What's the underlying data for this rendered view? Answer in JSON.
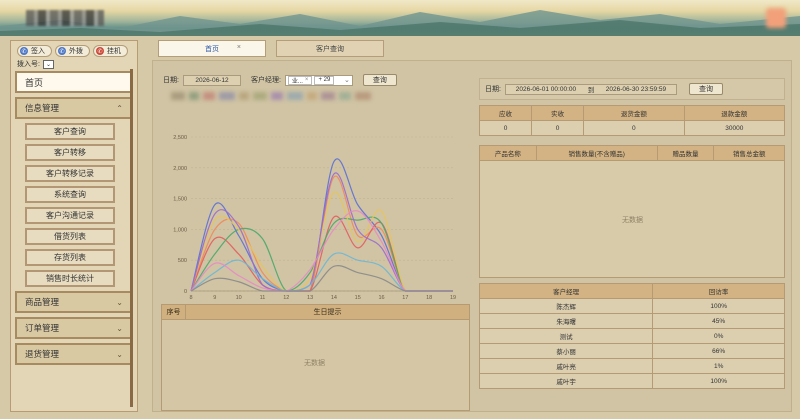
{
  "sidebar": {
    "buttons": [
      {
        "label": "签入",
        "color": "#4d77c6"
      },
      {
        "label": "外拨",
        "color": "#4d77c6"
      },
      {
        "label": "挂机",
        "color": "#cc4a3a"
      }
    ],
    "ext_label": "拨入号:",
    "home": "首页",
    "groups": [
      {
        "label": "信息管理",
        "expanded": true,
        "items": [
          "客户查询",
          "客户转移",
          "客户转移记录",
          "系统查询",
          "客户沟通记录",
          "借货列表",
          "存货列表",
          "销售时长统计"
        ]
      },
      {
        "label": "商品管理",
        "expanded": false
      },
      {
        "label": "订单管理",
        "expanded": false
      },
      {
        "label": "退货管理",
        "expanded": false
      }
    ]
  },
  "tabs": [
    {
      "label": "首页",
      "active": true,
      "close": "×"
    },
    {
      "label": "客户查询",
      "active": false
    }
  ],
  "filter": {
    "date_label": "日期:",
    "date_value": "2026-06-12",
    "manager_label": "客户经理:",
    "manager_tag": "业...",
    "manager_more": "+ 29",
    "query": "查询"
  },
  "chart_data": {
    "type": "line",
    "x": [
      8,
      9,
      10,
      11,
      12,
      13,
      14,
      15,
      16,
      17,
      18,
      19
    ],
    "ylim": [
      0,
      2500
    ],
    "yticks": [
      0,
      500,
      1000,
      1500,
      2000,
      2500
    ],
    "ytick_labels": [
      "0",
      "500",
      "1,000",
      "1,500",
      "2,000",
      "2,500"
    ],
    "series": [
      {
        "color": "#5b6fd6",
        "values": [
          0,
          1400,
          900,
          200,
          0,
          0,
          2100,
          1400,
          900,
          0,
          0,
          0
        ]
      },
      {
        "color": "#f08a5a",
        "values": [
          0,
          1000,
          1100,
          300,
          0,
          0,
          1850,
          900,
          1000,
          0,
          0,
          0
        ]
      },
      {
        "color": "#e35d5d",
        "values": [
          0,
          850,
          600,
          100,
          0,
          0,
          1200,
          700,
          1100,
          0,
          0,
          0
        ]
      },
      {
        "color": "#4aa86a",
        "values": [
          0,
          600,
          1000,
          850,
          0,
          300,
          1100,
          1150,
          1100,
          0,
          0,
          0
        ]
      },
      {
        "color": "#e8c45a",
        "values": [
          0,
          1150,
          1000,
          400,
          0,
          200,
          1600,
          800,
          1300,
          0,
          0,
          0
        ]
      },
      {
        "color": "#9a6ad0",
        "values": [
          0,
          1250,
          1050,
          100,
          0,
          100,
          1900,
          1000,
          700,
          0,
          0,
          0
        ]
      },
      {
        "color": "#6ab7d6",
        "values": [
          0,
          300,
          500,
          200,
          0,
          100,
          600,
          500,
          400,
          0,
          0,
          0
        ]
      },
      {
        "color": "#e88ac8",
        "values": [
          0,
          450,
          250,
          50,
          0,
          350,
          1000,
          1300,
          800,
          0,
          0,
          0
        ]
      },
      {
        "color": "#8a8a8a",
        "values": [
          0,
          200,
          150,
          0,
          0,
          0,
          400,
          300,
          200,
          0,
          0,
          0
        ]
      }
    ]
  },
  "birthday": {
    "col_index": "序号",
    "col_title": "生日提示",
    "empty": "无数据"
  },
  "right": {
    "date_label": "日期:",
    "start": "2026-06-01 00:00:00",
    "to": "到",
    "end": "2026-06-30 23:59:59",
    "query": "查询",
    "summary_headers": [
      "应收",
      "实收",
      "退货金额",
      "退款金额"
    ],
    "summary_values": [
      "0",
      "0",
      "0",
      "30000"
    ],
    "product_headers": [
      "产品名称",
      "销售数量(不含赠品)",
      "赠品数量",
      "销售总金额"
    ],
    "product_empty": "无数据",
    "visit_headers": [
      "客户经理",
      "回访率"
    ],
    "visits": [
      {
        "name": "陈杰辉",
        "rate": "100%"
      },
      {
        "name": "朱海曙",
        "rate": "45%"
      },
      {
        "name": "测试",
        "rate": "0%"
      },
      {
        "name": "蔡小丽",
        "rate": "66%"
      },
      {
        "name": "戚叶亮",
        "rate": "1%"
      },
      {
        "name": "戚叶宇",
        "rate": "100%"
      }
    ]
  }
}
